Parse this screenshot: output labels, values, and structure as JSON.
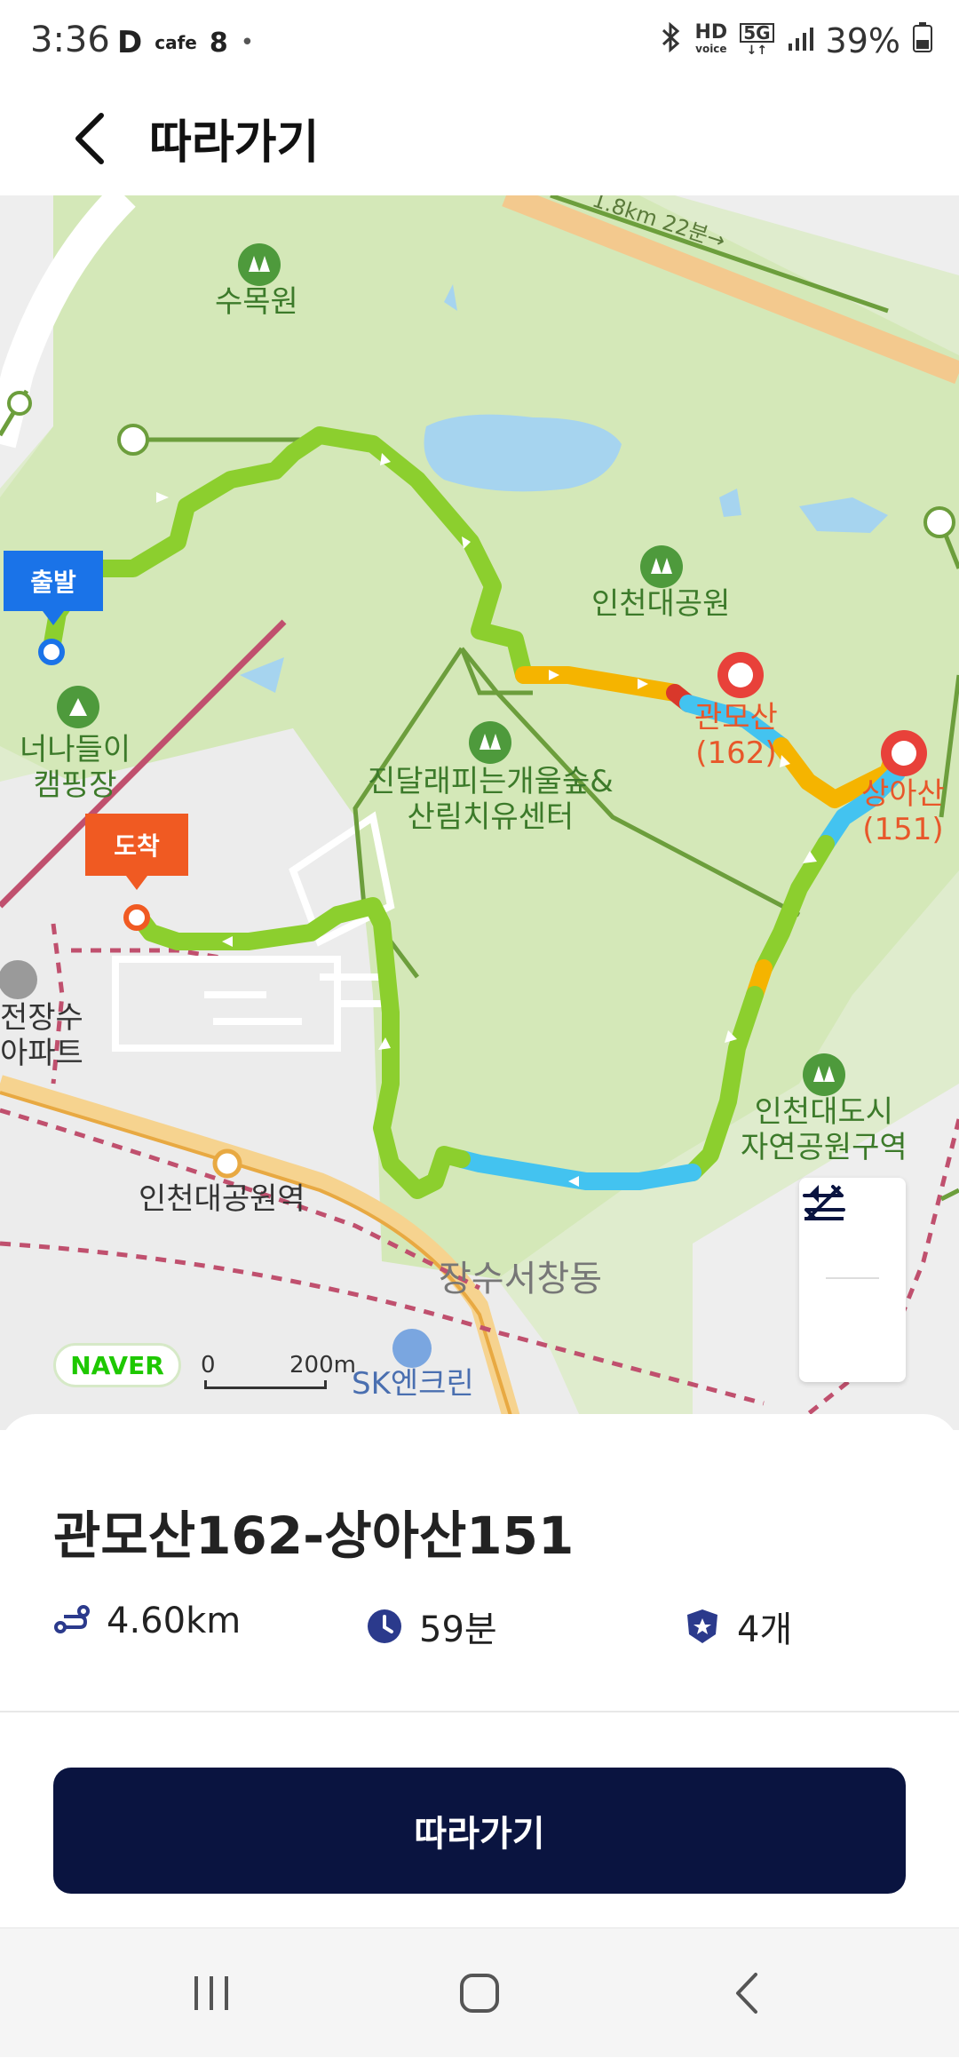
{
  "status_bar": {
    "time": "3:36",
    "app_icons": [
      "D",
      "cafe",
      "8",
      "•"
    ],
    "hd_label": "HD",
    "voice_label": "voice",
    "network_label": "5G",
    "battery_percent": "39%"
  },
  "header": {
    "title": "따라가기"
  },
  "map": {
    "labels": {
      "arboretum": "수목원",
      "incheon_grand_park": "인천대공원",
      "gwanmosan": "관모산",
      "gwanmosan_height": "(162)",
      "sangasan": "상아산",
      "sangasan_height": "(151)",
      "camping_line1": "너나들이",
      "camping_line2": "캠핑장",
      "forest_line1": "진달래피는개울숲&",
      "forest_line2": "산림치유센터",
      "apartment_line1": "전장수",
      "apartment_line2": "아파트",
      "station": "인천대공원역",
      "urban_park_line1": "인천대도시",
      "urban_park_line2": "자연공원구역",
      "district": "장수서창동",
      "gas_station": "SK엔크린",
      "road_distance": "1.8km 22분→"
    },
    "start_pin": "출발",
    "end_pin": "도착",
    "naver_logo": "NAVER",
    "scale_zero": "0",
    "scale_distance": "200m",
    "controls": {
      "elevation_icon": "elevation-icon",
      "reverse_icon": "reverse-route-icon"
    }
  },
  "course": {
    "title": "관모산162-상아산151",
    "distance": "4.60km",
    "duration": "59분",
    "peaks": "4개"
  },
  "follow_button": "따라가기",
  "colors": {
    "route_green": "#8ccf2e",
    "route_orange": "#f5b400",
    "route_blue": "#43c3f0",
    "route_red": "#d9382b",
    "button_navy": "#0a1440",
    "start_blue": "#1a73e8",
    "end_orange": "#f05a22"
  }
}
